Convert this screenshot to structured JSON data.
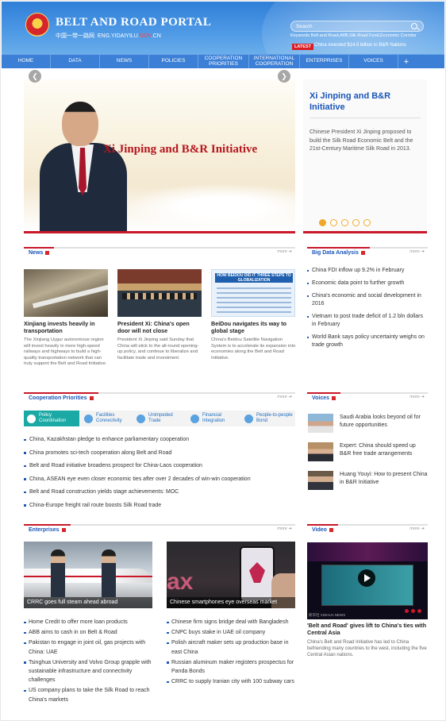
{
  "header": {
    "site_title": "BELT AND ROAD PORTAL",
    "sub_cn": "中国一带一路网",
    "sub_domain_a": "ENG.YIDAIYILU.",
    "sub_domain_b": "GOV",
    "sub_domain_c": ".CN",
    "search_placeholder": "Search",
    "keywords": "Keywords Belt and Road,AIIB,Silk Road Fund,Economic Corridor",
    "latest_badge": "LATEST",
    "latest_text": "China invested $14.5 billion in B&R Nations"
  },
  "nav": {
    "items": [
      "HOME",
      "DATA",
      "NEWS",
      "POLICIES",
      "COOPERATION PRIORITIES",
      "INTERNATIONAL COOPERATION",
      "ENTERPRISES",
      "VOICES"
    ],
    "plus": "+"
  },
  "hero": {
    "caption": "Xi Jinping and B&R Initiative",
    "side_title": "Xi Jinping and B&R Initiative",
    "side_desc": "Chinese President Xi Jinping proposed to build the Silk Road Economic Belt and the 21st-Century Maritime Silk Road in 2013.",
    "prev": "❮",
    "next": "❯"
  },
  "news": {
    "title": "News",
    "more": "more",
    "items": [
      {
        "title": "Xinjiang invests heavily in transportation",
        "desc": "The Xinjiang Uygur autonomous region will invest heavily in more high-speed railways and highways to build a high-quality transportation network that can truly support the Belt and Road Initiative."
      },
      {
        "title": "President Xi: China's open door will not close",
        "desc": "President Xi Jinping said Sunday that China will stick to the all-round opening-up policy, and continue to liberalize and facilitate trade and investment."
      },
      {
        "title": "BeiDou navigates its way to global stage",
        "desc": "China's Beidou Satellite Navigation System is to accelerate its expansion into economies along the Belt and Road Initiative."
      }
    ],
    "beidou_img_text": "HOW BEIDOU DID IT THREE STEPS TO GLOBALIZATION"
  },
  "big_data": {
    "title": "Big Data Analysis",
    "more": "more",
    "items": [
      "China FDI inflow up 9.2% in February",
      "Economic data point to further growth",
      "China's economic and social development in 2016",
      "Vietnam to post trade deficit of 1.2 bln dollars in February",
      "World Bank says policy uncertainty weighs on trade growth"
    ]
  },
  "cooperation": {
    "title": "Cooperation Priorities",
    "more": "more",
    "tabs": [
      "Policy Coordination",
      "Facilities Connectivity",
      "Unimpeded Trade",
      "Financial Integration",
      "People-to-people Bond"
    ],
    "items": [
      "China, Kazakhstan pledge to enhance parliamentary cooperation",
      "China promotes sci-tech cooperation along Belt and Road",
      "Belt and Road initiative broadens prospect for China-Laos cooperation",
      "China, ASEAN eye even closer economic ties after over 2 decades of win-win cooperation",
      "Belt and Road construction yields stage achievements: MOC",
      "China-Europe freight rail route boosts Silk Road trade"
    ]
  },
  "voices": {
    "title": "Voices",
    "more": "more",
    "items": [
      "Saudi Arabia looks beyond oil for future opportunities",
      "Expert: China should speed up B&R free trade arrangements",
      "Huang Youyi: How to present China in B&R Initiative"
    ]
  },
  "enterprises": {
    "title": "Enterprises",
    "more": "more",
    "img1_caption": "CRRC goes full steam ahead abroad",
    "img2_caption": "Chinese smartphones eye overseas market",
    "img2_big": "ax",
    "left_items": [
      "Home Credit to offer more loan products",
      "ABB aims to cash in on Belt & Road",
      "Pakistan to engage in joint oil, gas projects with China: UAE",
      "Tsinghua University and Volvo Group grapple with sustainable infrastructure and connectivity challenges",
      "US company plans to take the Silk Road to reach China's markets"
    ],
    "right_items": [
      "Chinese firm signs bridge deal with Bangladesh",
      "CNPC buys stake in UAE oil company",
      "Polish aircraft maker sets up production base in east China",
      "Russian aluminum maker registers prospectus for Panda Bonds",
      "CRRC to supply Iranian city with 100 subway cars"
    ]
  },
  "video": {
    "title_text": "Video",
    "more": "more",
    "title": "'Belt and Road' gives lift to China's ties with Central Asia",
    "desc": "China's Belt and Road Initiative has led to China befriending many countries to the west, including the five Central Asian nations.",
    "tiny": "新华社 XINHUA NEWS"
  }
}
